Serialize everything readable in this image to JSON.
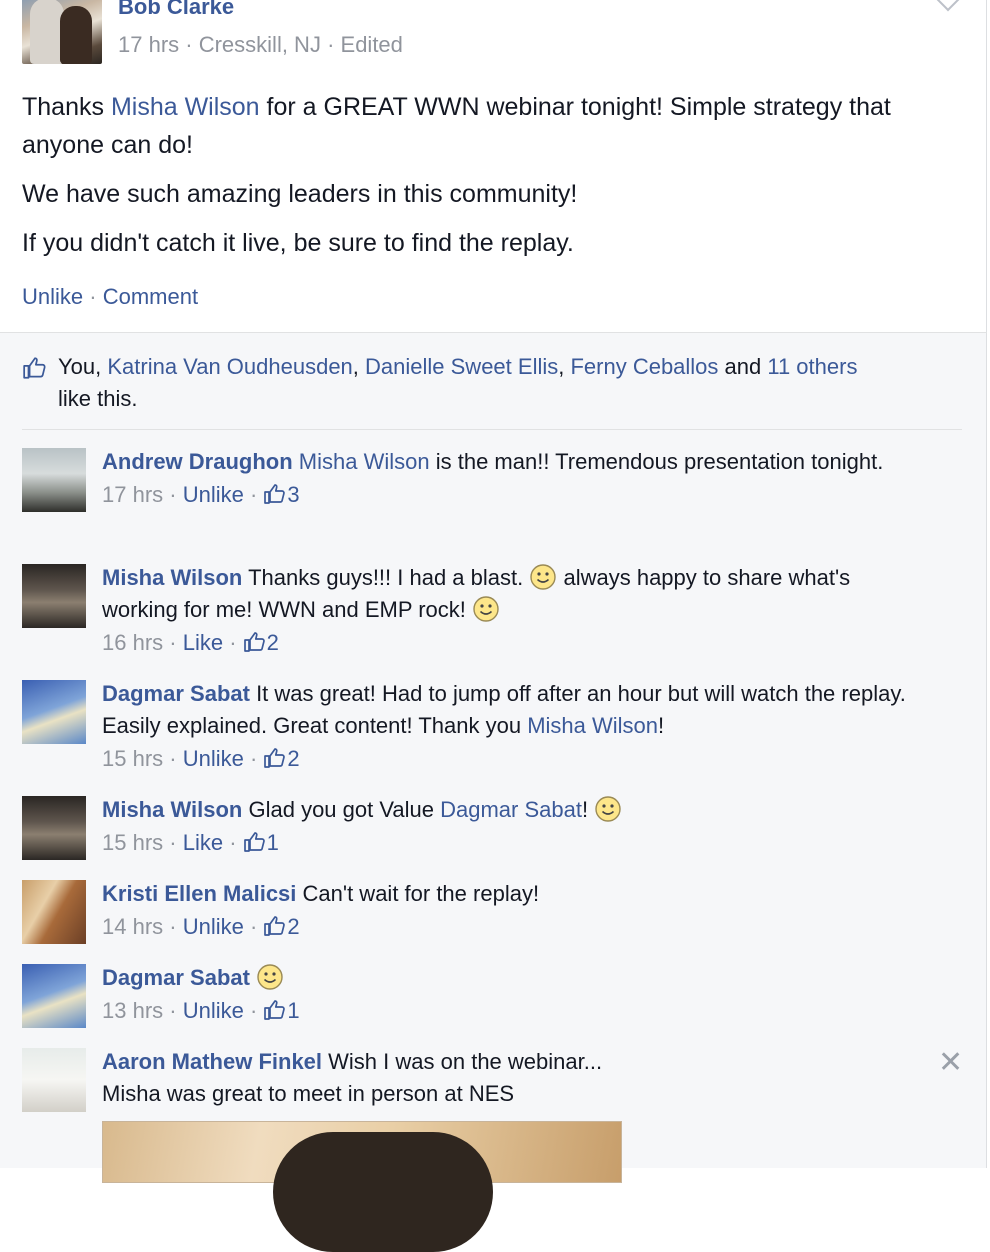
{
  "post": {
    "author": "Bob Clarke",
    "time": "17 hrs",
    "location": "Cresskill, NJ",
    "edited": "Edited",
    "sep": " · ",
    "body": {
      "p1_a": "Thanks ",
      "p1_link": "Misha Wilson",
      "p1_b": " for a GREAT WWN webinar tonight! Simple strategy that anyone can do!",
      "p2": "We have such amazing leaders in this community!",
      "p3": "If you didn't catch it live, be sure to find the replay."
    },
    "actions": {
      "unlike": "Unlike",
      "comment": "Comment"
    }
  },
  "likes": {
    "you": "You",
    "names": [
      "Katrina Van Oudheusden",
      "Danielle Sweet Ellis",
      "Ferny Ceballos"
    ],
    "and": " and ",
    "others": "11 others",
    "tail": "like this."
  },
  "comments": [
    {
      "author": "Andrew Draughon",
      "mention": "Misha Wilson",
      "text": " is the man!! Tremendous presentation tonight.",
      "time": "17 hrs",
      "action": "Unlike",
      "likes": "3"
    },
    {
      "author": "Misha Wilson",
      "text_a": " Thanks guys!!! I had a blast. ",
      "text_b": " always happy to share what's working for me! WWN and EMP rock! ",
      "time": "16 hrs",
      "action": "Like",
      "likes": "2"
    },
    {
      "author": "Dagmar Sabat",
      "text": " It was great! Had to jump off after an hour but will watch the replay. Easily explained. Great content! Thank you ",
      "mention": "Misha Wilson",
      "tail": "!",
      "time": "15 hrs",
      "action": "Unlike",
      "likes": "2"
    },
    {
      "author": "Misha Wilson",
      "text": " Glad you got Value ",
      "mention": "Dagmar Sabat",
      "tail": "! ",
      "time": "15 hrs",
      "action": "Like",
      "likes": "1"
    },
    {
      "author": "Kristi Ellen Malicsi",
      "text": " Can't wait for the replay!",
      "time": "14 hrs",
      "action": "Unlike",
      "likes": "2"
    },
    {
      "author": "Dagmar Sabat",
      "text": " ",
      "time": "13 hrs",
      "action": "Unlike",
      "likes": "1"
    },
    {
      "author": "Aaron Mathew Finkel",
      "text": " Wish I was on the webinar...",
      "line2": "Misha was great to meet in person at NES"
    }
  ],
  "icons": {
    "like": "thumbs-up-icon",
    "smiley": "smiley-emoji-icon",
    "close": "close-icon",
    "chevron": "chevron-down-icon"
  },
  "colors": {
    "link": "#3b5998",
    "meta": "#90949c",
    "feedback_bg": "#f6f7f9"
  },
  "close_glyph": "✕"
}
